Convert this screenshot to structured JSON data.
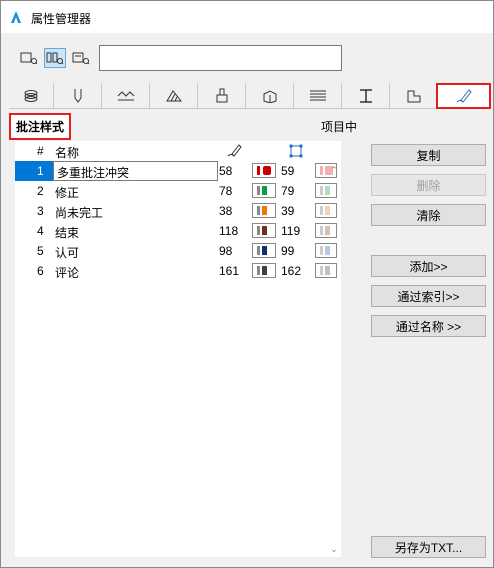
{
  "window": {
    "title": "属性管理器"
  },
  "toolbar": {
    "search_value": ""
  },
  "section": {
    "label": "批注样式",
    "in_project_label": "项目中"
  },
  "table": {
    "columns": [
      "#",
      "名称"
    ],
    "rows": [
      {
        "num": "1",
        "name": "多重批注冲突",
        "pen1": "58",
        "pen2": "59",
        "color1": "#cc0000",
        "color2": "#f4b0b0"
      },
      {
        "num": "2",
        "name": "修正",
        "pen1": "78",
        "pen2": "79",
        "color1": "#00a050",
        "color2": "#a8e0c0"
      },
      {
        "num": "3",
        "name": "尚未完工",
        "pen1": "38",
        "pen2": "39",
        "color1": "#f07800",
        "color2": "#f8d0b0"
      },
      {
        "num": "4",
        "name": "结束",
        "pen1": "118",
        "pen2": "119",
        "color1": "#703020",
        "color2": "#d8c0b8"
      },
      {
        "num": "5",
        "name": "认可",
        "pen1": "98",
        "pen2": "99",
        "color1": "#103070",
        "color2": "#b8c8e0"
      },
      {
        "num": "6",
        "name": "评论",
        "pen1": "161",
        "pen2": "162",
        "color1": "#404040",
        "color2": "#c0c0c0"
      }
    ]
  },
  "buttons": {
    "copy": "复制",
    "delete": "删除",
    "clear": "清除",
    "add": "添加>>",
    "by_index": "通过索引>>",
    "by_name": "通过名称 >>",
    "save_txt": "另存为TXT..."
  }
}
